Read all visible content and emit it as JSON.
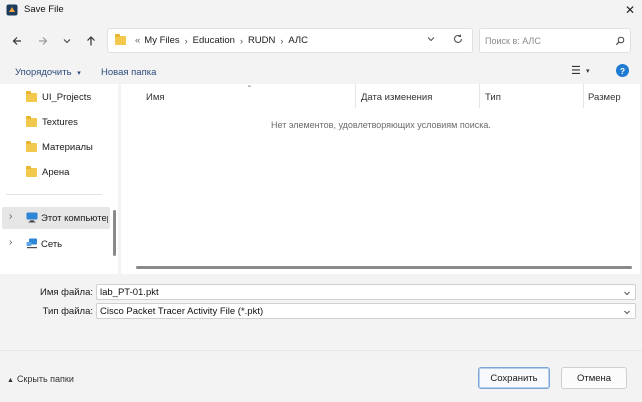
{
  "window": {
    "title": "Save File",
    "close_glyph": "✕"
  },
  "nav": {
    "back_icon": "arrow-left-icon",
    "forward_icon": "arrow-right-icon",
    "recent_icon": "chevron-down-icon",
    "up_icon": "arrow-up-icon"
  },
  "address": {
    "overflow": "«",
    "crumbs": [
      "My Files",
      "Education",
      "RUDN",
      "АЛС"
    ],
    "dropdown_glyph": "⌄",
    "refresh_glyph": "↻"
  },
  "search": {
    "placeholder": "Поиск в: АЛС"
  },
  "toolbar": {
    "organize_label": "Упорядочить",
    "organize_caret": "▾",
    "new_folder_label": "Новая папка",
    "view_glyph": "☰",
    "view_caret": "▾",
    "help_glyph": "?"
  },
  "sidebar": {
    "folders": [
      {
        "label": "UI_Projects"
      },
      {
        "label": "Textures"
      },
      {
        "label": "Материалы"
      },
      {
        "label": "Арена"
      }
    ],
    "this_pc_label": "Этот компьютер",
    "network_label": "Сеть",
    "expand_glyph": "›"
  },
  "file_list": {
    "columns": [
      "Имя",
      "Дата изменения",
      "Тип",
      "Размер"
    ],
    "empty_message": "Нет элементов, удовлетворяющих условиям поиска."
  },
  "form": {
    "filename_label": "Имя файла:",
    "filename_value": "lab_PT-01.pkt",
    "filetype_label": "Тип файла:",
    "filetype_value": "Cisco Packet Tracer Activity File (*.pkt)"
  },
  "footer": {
    "hide_folders_label": "Скрыть папки",
    "save_label": "Сохранить",
    "cancel_label": "Отмена"
  },
  "colors": {
    "accent": "#1f7ad1",
    "folder": "#f2c94c"
  }
}
